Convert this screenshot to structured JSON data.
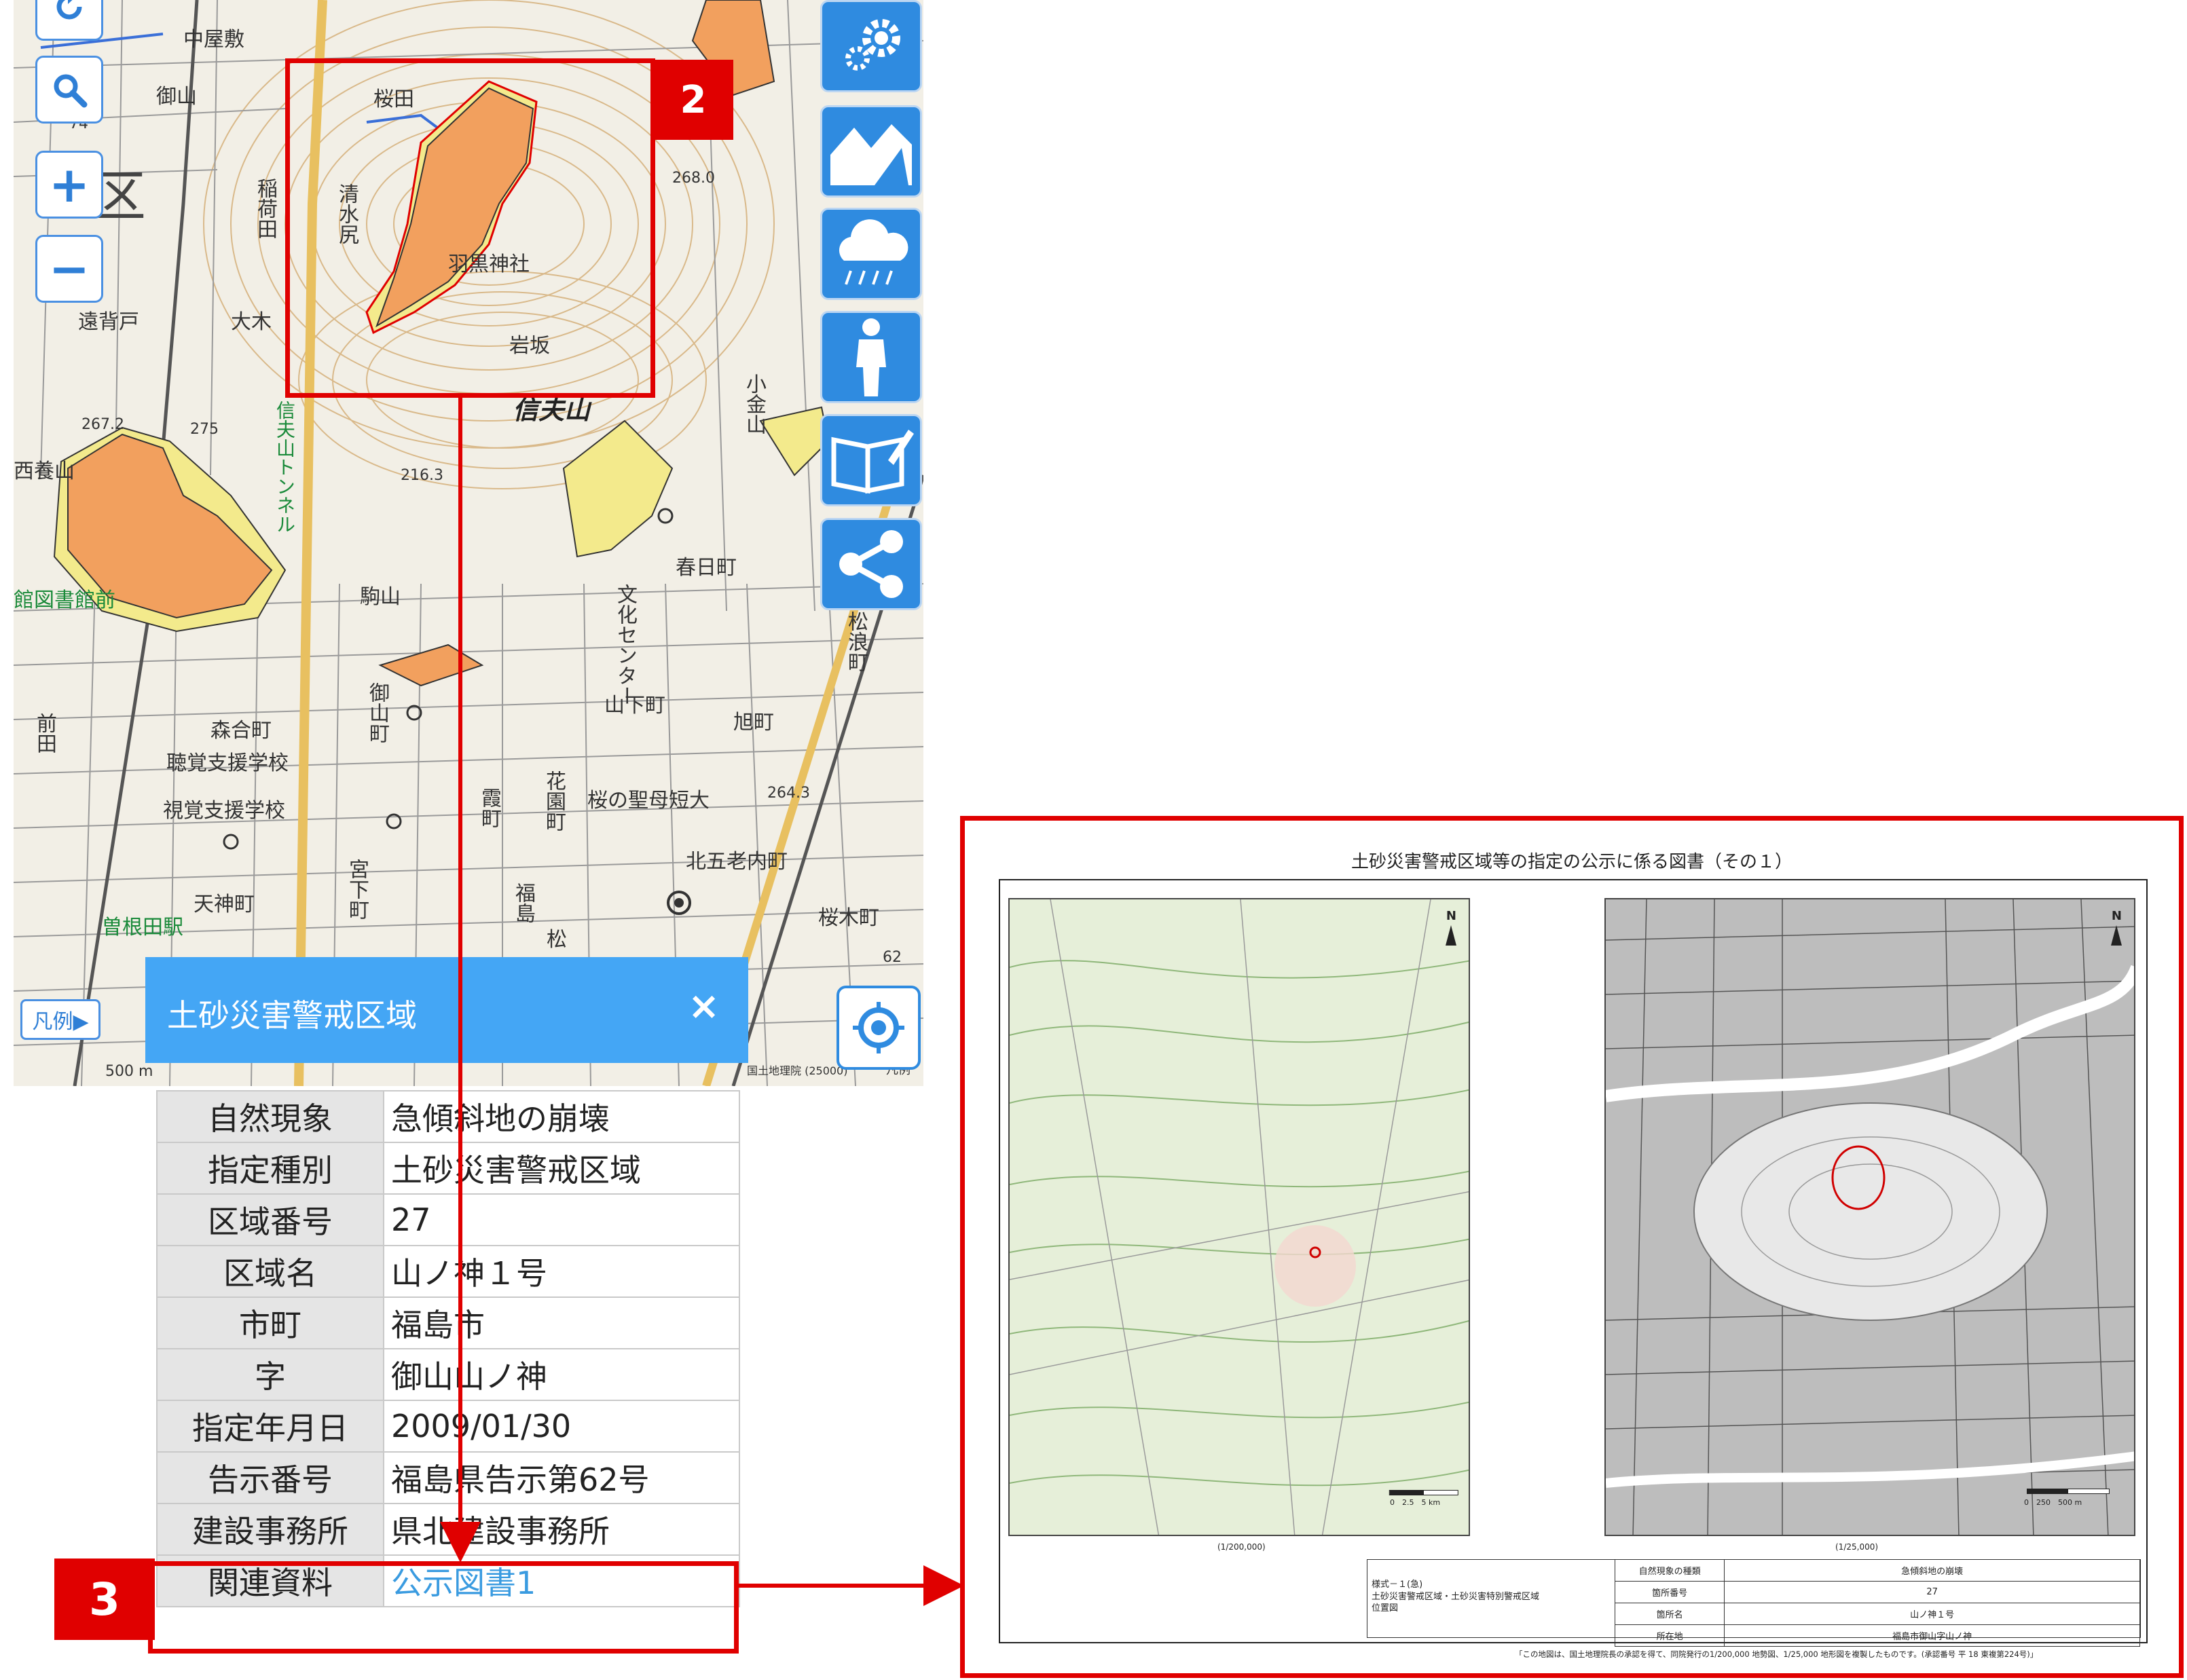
{
  "map": {
    "labels": [
      {
        "text": "中屋敷"
      },
      {
        "text": "御山"
      },
      {
        "text": "桜田"
      },
      {
        "text": "区"
      },
      {
        "text": "清水尻"
      },
      {
        "text": "稲荷田"
      },
      {
        "text": "羽黒神社"
      },
      {
        "text": "岩坂"
      },
      {
        "text": "遠背戸"
      },
      {
        "text": "大木"
      },
      {
        "text": "信夫山"
      },
      {
        "text": "信夫山トンネル"
      },
      {
        "text": "西養山"
      },
      {
        "text": "館図書館前"
      },
      {
        "text": "駒山"
      },
      {
        "text": "春日町"
      },
      {
        "text": "文化センター"
      },
      {
        "text": "山下町"
      },
      {
        "text": "旭町"
      },
      {
        "text": "森合町"
      },
      {
        "text": "聴覚支援学校"
      },
      {
        "text": "視覚支援学校"
      },
      {
        "text": "御山町"
      },
      {
        "text": "霞町"
      },
      {
        "text": "花園町"
      },
      {
        "text": "桜の聖母短大"
      },
      {
        "text": "北五老内町"
      },
      {
        "text": "天神町"
      },
      {
        "text": "宮下町"
      },
      {
        "text": "曽根田駅"
      },
      {
        "text": "桜木町"
      },
      {
        "text": "前田"
      },
      {
        "text": "小金山"
      },
      {
        "text": "松浪町"
      },
      {
        "text": "福島"
      },
      {
        "text": "松"
      },
      {
        "text": "267.2"
      },
      {
        "text": "275"
      },
      {
        "text": "216.3"
      },
      {
        "text": "268.0"
      },
      {
        "text": "264.3"
      },
      {
        "text": "62"
      },
      {
        "text": "74"
      },
      {
        "text": "500 m"
      },
      {
        "text": "国土地理院 (25000)"
      },
      {
        "text": "凡例"
      }
    ]
  },
  "controls": {
    "search_icon": "search-icon",
    "zoom_in": "+",
    "zoom_out": "−",
    "legend_label": "凡例▶",
    "right_icons": [
      "gear-icon",
      "landslide-icon",
      "rain-icon",
      "person-icon",
      "book-edit-icon",
      "share-icon"
    ]
  },
  "popup": {
    "title": "土砂災害警戒区域",
    "close": "×",
    "rows": [
      {
        "key": "自然現象",
        "value": "急傾斜地の崩壊"
      },
      {
        "key": "指定種別",
        "value": "土砂災害警戒区域"
      },
      {
        "key": "区域番号",
        "value": "27"
      },
      {
        "key": "区域名",
        "value": "山ノ神１号"
      },
      {
        "key": "市町",
        "value": "福島市"
      },
      {
        "key": "字",
        "value": "御山山ノ神"
      },
      {
        "key": "指定年月日",
        "value": "2009/01/30"
      },
      {
        "key": "告示番号",
        "value": "福島県告示第62号"
      },
      {
        "key": "建設事務所",
        "value": "県北建設事務所"
      },
      {
        "key": "関連資料",
        "value": "公示図書1"
      }
    ]
  },
  "annotations": {
    "step2": "2",
    "step3": "3"
  },
  "document": {
    "title": "土砂災害警戒区域等の指定の公示に係る図書（その１）",
    "scale_left": "(1/200,000)",
    "scale_right": "(1/25,000)",
    "scalebar_left": "0　2.5　5 km",
    "scalebar_right": "0　250　500 m",
    "north": "N",
    "form_title": "様式－１(急)\n土砂災害警戒区域・土砂災害特別警戒区域\n位置図",
    "table": [
      {
        "key": "自然現象の種類",
        "value": "急傾斜地の崩壊"
      },
      {
        "key": "箇所番号",
        "value": "27"
      },
      {
        "key": "箇所名",
        "value": "山ノ神１号"
      },
      {
        "key": "所在地",
        "value": "福島市御山字山ノ神"
      }
    ],
    "note": "「この地図は、国土地理院長の承認を得て、同院発行の1/200,000 地勢図、1/25,000 地形図を複製したものです。(承認番号 平 18 東複第224号)」"
  },
  "colors": {
    "accent": "#44a6f5",
    "annotation": "#e00000",
    "hazard_orange": "#f2a05e",
    "hazard_yellow": "#f3ea8c",
    "link": "#3a9be0"
  }
}
